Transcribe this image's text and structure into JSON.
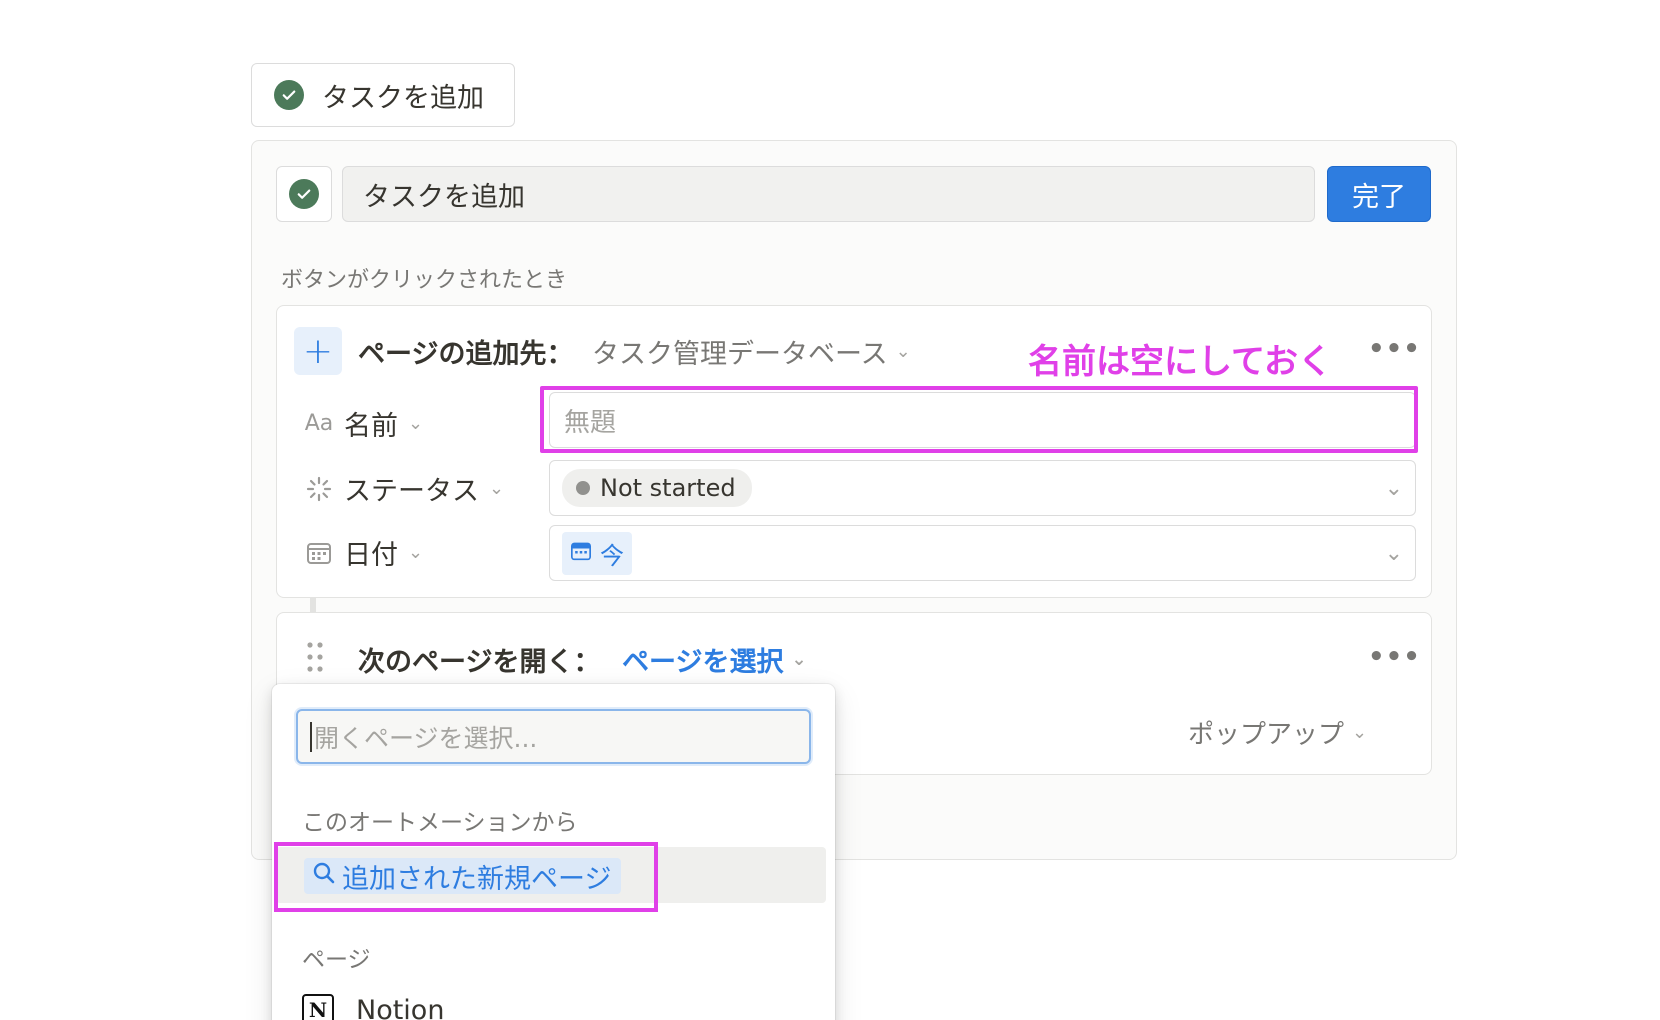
{
  "button_chip": {
    "label": "タスクを追加",
    "icon": "check-circle-icon"
  },
  "editor": {
    "name_value": "タスクを追加",
    "done_label": "完了",
    "trigger_label": "ボタンがクリックされたとき"
  },
  "add_page_action": {
    "label": "ページの追加先：",
    "database": "タスク管理データベース",
    "annotation": "名前は空にしておく",
    "properties": [
      {
        "icon": "text-aa-icon",
        "icon_text": "Aa",
        "name": "名前",
        "placeholder": "無題"
      },
      {
        "icon": "status-spinner-icon",
        "name": "ステータス",
        "value": "Not started"
      },
      {
        "icon": "calendar-icon",
        "name": "日付",
        "value": "今"
      }
    ]
  },
  "open_page_action": {
    "label": "次のページを開く：",
    "select_label": "ページを選択",
    "mode": "ポップアップ"
  },
  "dropdown": {
    "search_placeholder": "開くページを選択...",
    "section_automation": "このオートメーションから",
    "new_page_item": "追加された新規ページ",
    "section_pages": "ページ",
    "pages": [
      {
        "label": "Notion",
        "icon": "notion-logo-icon"
      }
    ]
  },
  "colors": {
    "accent": "#2e7de0",
    "annotation": "#e040e8",
    "check_green": "#4c7a5a"
  }
}
